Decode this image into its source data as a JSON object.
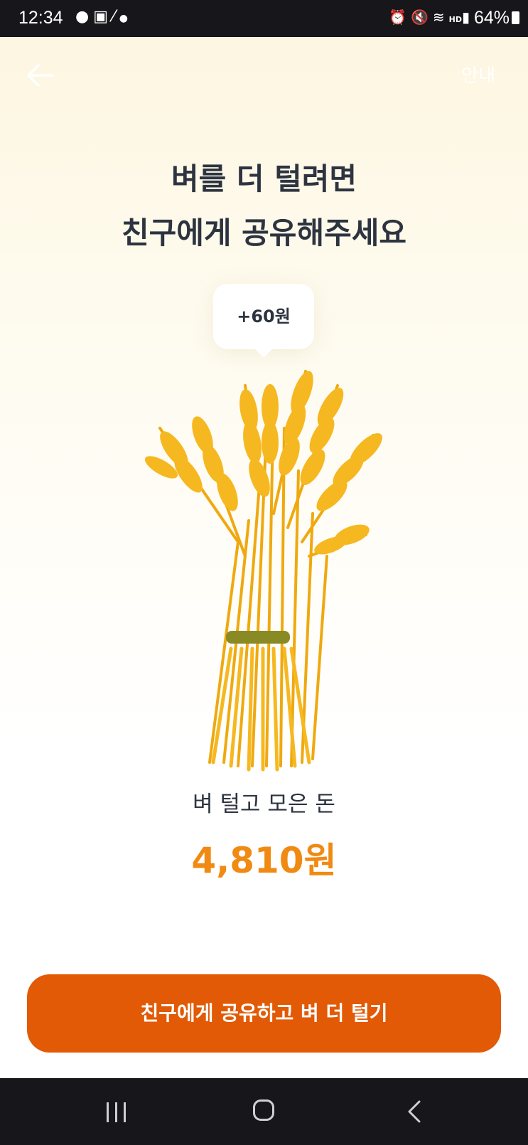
{
  "status_bar": {
    "time": "12:34",
    "left_icons": [
      "messenger-icon",
      "gallery-icon",
      "app-notification-icon",
      "dot-icon"
    ],
    "right_icons": [
      "alarm-icon",
      "mute-icon",
      "wifi-icon",
      "hd-voice-icon",
      "signal-icon"
    ],
    "battery": "64%"
  },
  "header": {
    "back_icon": "arrow-left-icon",
    "guide_label": "안내"
  },
  "main": {
    "headline_line1": "벼를 더 털려면",
    "headline_line2": "친구에게 공유해주세요",
    "bubble_text": "+60원",
    "illustration": "wheat-sheaf",
    "total_label": "벼 털고 모은 돈",
    "total_amount": "4,810원"
  },
  "share_button": {
    "label": "친구에게 공유하고 벼 더 털기"
  },
  "nav_bar": {
    "recents_icon": "recents-icon",
    "home_icon": "home-icon",
    "back_icon": "back-icon"
  },
  "colors": {
    "accent": "#e25a05",
    "amount": "#f08a13",
    "text": "#2d3440",
    "wheat": "#f6b820"
  }
}
